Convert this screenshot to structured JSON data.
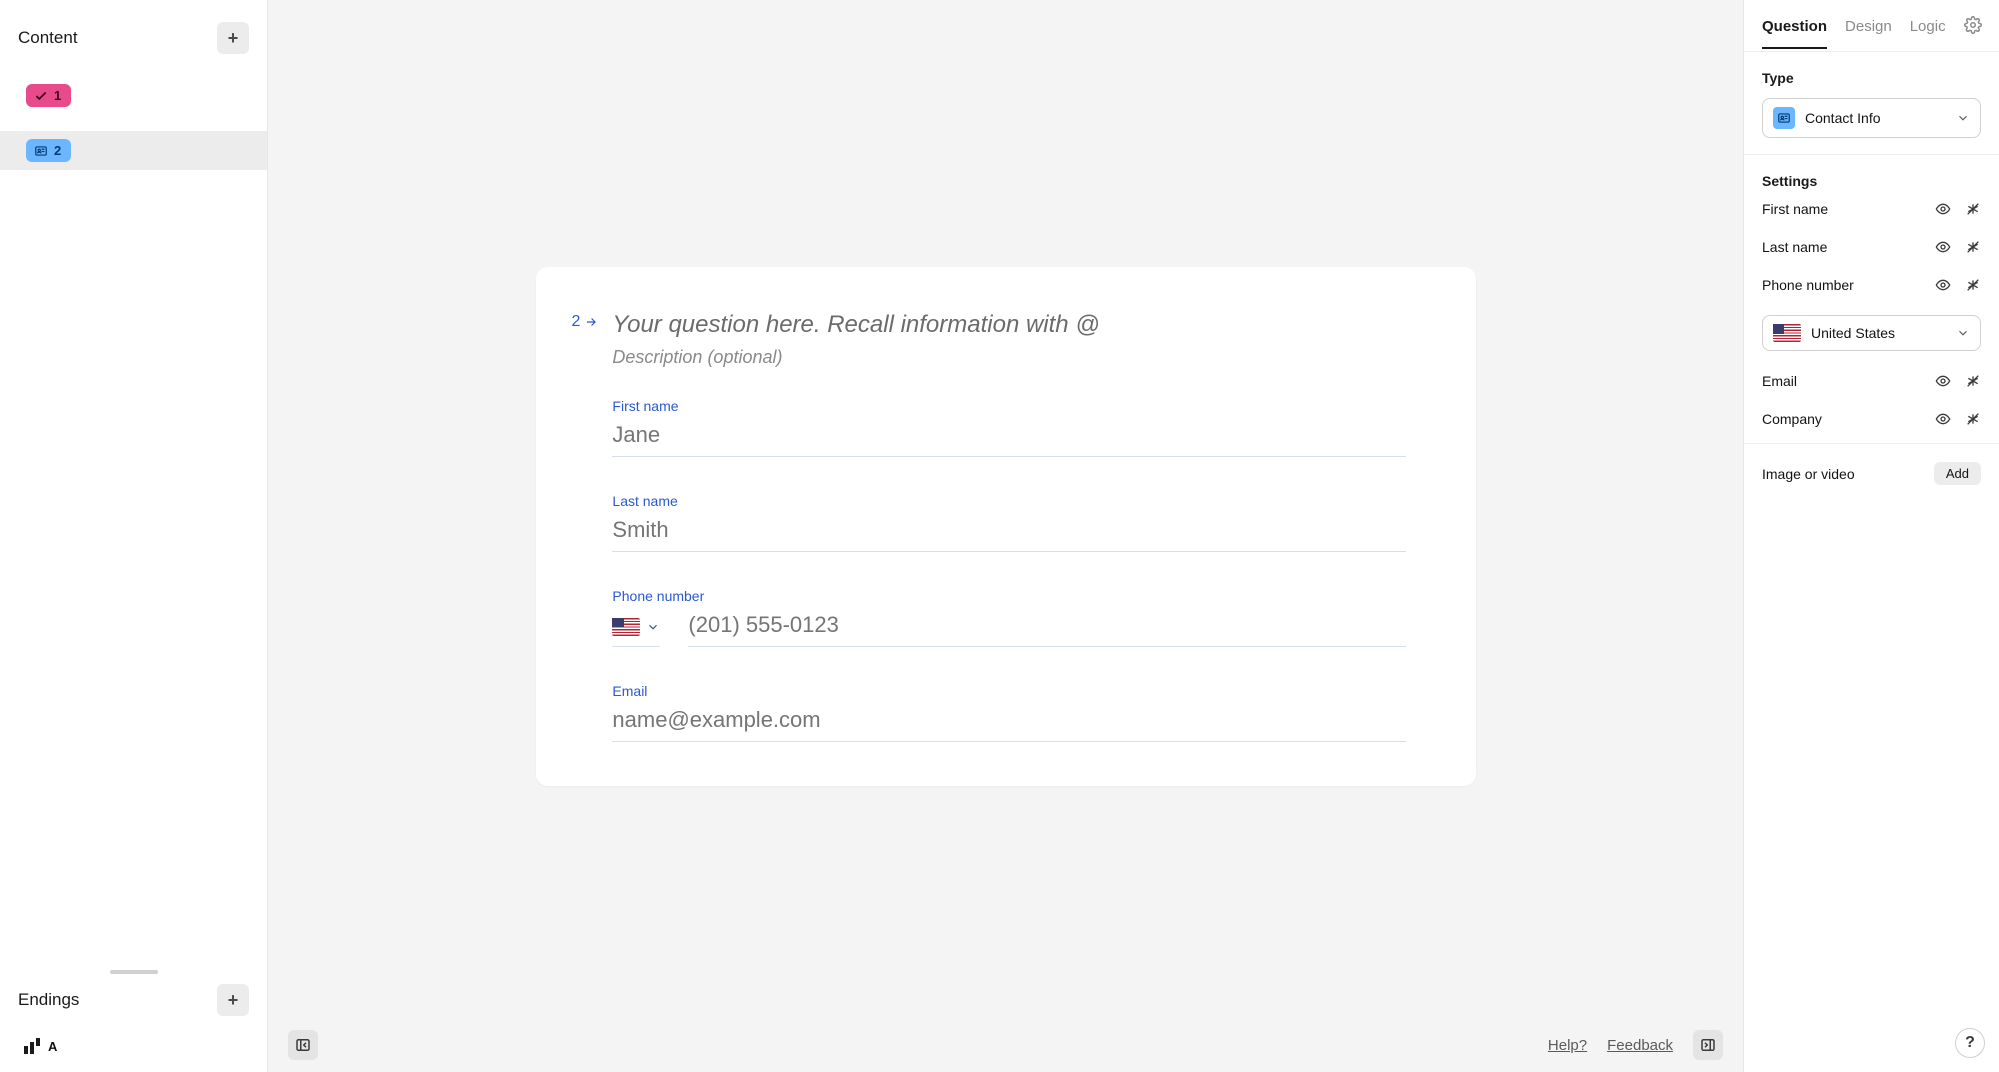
{
  "left": {
    "content_title": "Content",
    "endings_title": "Endings",
    "items": [
      {
        "index": "1",
        "type": "welcome"
      },
      {
        "index": "2",
        "type": "contact"
      }
    ],
    "ending": {
      "index": "A"
    }
  },
  "canvas": {
    "question_number": "2",
    "title_placeholder": "Your question here. Recall information with @",
    "desc_placeholder": "Description (optional)",
    "fields": {
      "first_name": {
        "label": "First name",
        "placeholder": "Jane"
      },
      "last_name": {
        "label": "Last name",
        "placeholder": "Smith"
      },
      "phone": {
        "label": "Phone number",
        "placeholder": "(201) 555-0123"
      },
      "email": {
        "label": "Email",
        "placeholder": "name@example.com"
      }
    }
  },
  "footer": {
    "help": "Help?",
    "feedback": "Feedback"
  },
  "right": {
    "tabs": {
      "question": "Question",
      "design": "Design",
      "logic": "Logic"
    },
    "type_label": "Type",
    "type_value": "Contact Info",
    "settings_label": "Settings",
    "settings": {
      "first_name": "First name",
      "last_name": "Last name",
      "phone": "Phone number",
      "country_value": "United States",
      "email": "Email",
      "company": "Company"
    },
    "media_label": "Image or video",
    "media_add": "Add"
  },
  "help_fab": "?"
}
